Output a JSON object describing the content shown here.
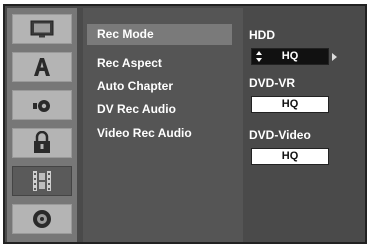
{
  "sidebar": {
    "items": [
      {
        "icon": "tv-icon"
      },
      {
        "icon": "language-icon"
      },
      {
        "icon": "audio-icon"
      },
      {
        "icon": "lock-icon"
      },
      {
        "icon": "recording-icon",
        "active": true
      },
      {
        "icon": "disc-icon"
      }
    ]
  },
  "menu": {
    "items": [
      {
        "label": "Rec Mode",
        "active": true
      },
      {
        "label": "Rec Aspect"
      },
      {
        "label": "Auto Chapter"
      },
      {
        "label": "DV Rec Audio"
      },
      {
        "label": "Video Rec Audio"
      }
    ]
  },
  "settings": {
    "hdd_label": "HDD",
    "hdd_value": "HQ",
    "dvdvr_label": "DVD-VR",
    "dvdvr_value": "HQ",
    "dvdvideo_label": "DVD-Video",
    "dvdvideo_value": "HQ"
  },
  "colors": {
    "panel": "#4a4a4a",
    "sidebar": "#777777",
    "highlight": "#7a7a7a"
  }
}
